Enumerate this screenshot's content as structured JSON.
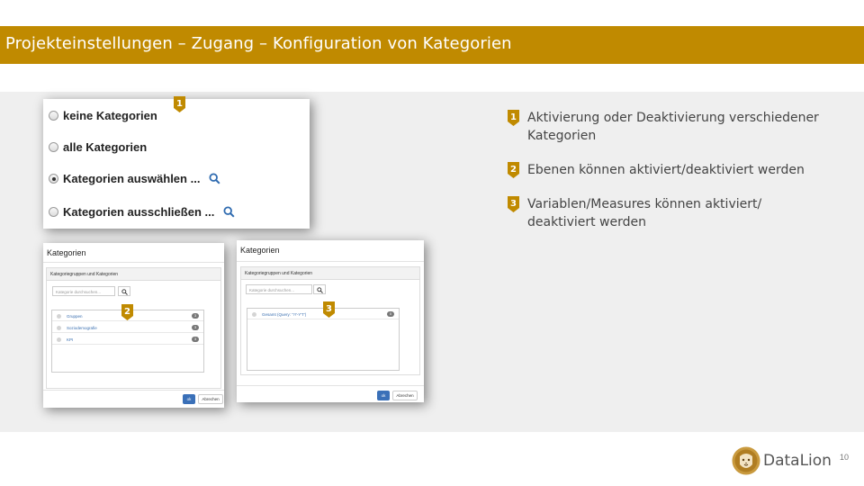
{
  "slide": {
    "title": "Projekteinstellungen – Zugang – Konfiguration von Kategorien",
    "page_number": "10",
    "brand_color": "#c08a00"
  },
  "radio_options": [
    {
      "label": "keine Kategorien",
      "checked": false,
      "has_search": false
    },
    {
      "label": "alle Kategorien",
      "checked": false,
      "has_search": false
    },
    {
      "label": "Kategorien auswählen ...",
      "checked": true,
      "has_search": true
    },
    {
      "label": "Kategorien ausschließen ...",
      "checked": false,
      "has_search": true
    }
  ],
  "dialog_left": {
    "title": "Kategorien",
    "panel_heading": "Kategoriegruppen und Kategorien",
    "search_placeholder": "Kategorie durchsuchen...",
    "items": [
      {
        "label": "Gruppen",
        "count": "3"
      },
      {
        "label": "Soziodemografie",
        "count": "3"
      },
      {
        "label": "KPI",
        "count": "3"
      }
    ],
    "ok_label": "ok",
    "cancel_label": "Abrechen"
  },
  "dialog_right": {
    "title": "Kategorien",
    "panel_heading": "Kategoriegruppen und Kategorien",
    "search_placeholder": "Kategorie durchsuchen...",
    "items": [
      {
        "label": "Gesamt (Query: '?!'-Y'T')",
        "count": "0"
      }
    ],
    "ok_label": "ok",
    "cancel_label": "Abrechen"
  },
  "markers": {
    "m1": "1",
    "m2": "2",
    "m3": "3"
  },
  "legend": [
    {
      "number": "1",
      "text": "Aktivierung oder Deaktivierung verschiedener Kategorien"
    },
    {
      "number": "2",
      "text": "Ebenen können aktiviert/deaktiviert werden"
    },
    {
      "number": "3",
      "text": "Variablen/Measures können aktiviert/ deaktiviert werden"
    }
  ],
  "logo": {
    "text": "DataLion",
    "icon": "lion-head-icon"
  }
}
